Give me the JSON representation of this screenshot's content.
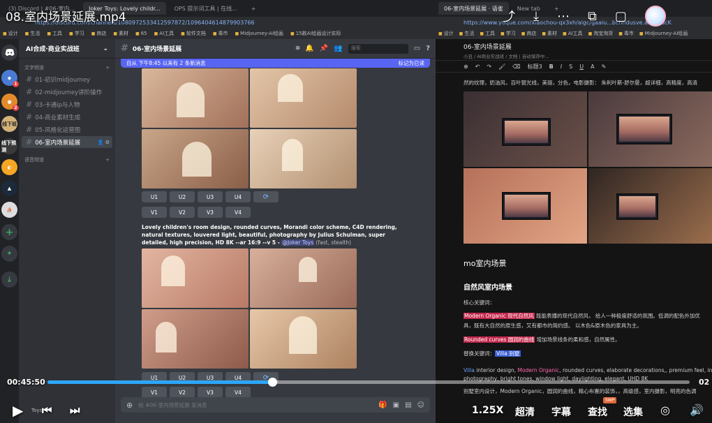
{
  "video": {
    "title": "08.室内场景延展.mp4",
    "time_current": "00:45:50",
    "time_end": "02",
    "progress": 0.35,
    "speed": "1.25X",
    "quality": "超清",
    "subtitle": "字幕",
    "search": "查找",
    "episodes": "选集",
    "swp_tag": "SWP"
  },
  "browser_left": {
    "tabs": [
      "(3) Discord | #06-室内...",
      "Joker Toys: Lovely childr...",
      "OPS 提示词工具 | 在线...",
      "+"
    ],
    "url": "https://discord.com/channels/1080972533412597872/1096404614879903766",
    "bookmarks": [
      "设计",
      "生活",
      "工具",
      "学习",
      "商店",
      "素材",
      "65",
      "AI工具",
      "软件文档",
      "毒市",
      "Midjourney-AI绘画",
      "15款AI绘画设计实际"
    ]
  },
  "discord": {
    "server_name": "AI合成·商业实战班",
    "category_text": "文字频道",
    "category_voice": "语音频道",
    "channels": [
      {
        "label": "01-初识midjourney"
      },
      {
        "label": "02-midjourney讲阶操作"
      },
      {
        "label": "03-卡通ip与人物"
      },
      {
        "label": "04-商业素材生成"
      },
      {
        "label": "05-风格化运营图"
      },
      {
        "label": "06-室内场景延展"
      }
    ],
    "guild_labels": [
      "线下班",
      "线下预测"
    ],
    "guild_badges": [
      "1",
      "2"
    ],
    "channel_title": "06-室内场景延展",
    "search_placeholder": "搜索",
    "new_messages": "自从 下午8:45 以来有 2 条新消息",
    "mark_read": "标记为已读",
    "upscale_buttons": [
      "U1",
      "U2",
      "U3",
      "U4"
    ],
    "variation_buttons": [
      "V1",
      "V2",
      "V3",
      "V4"
    ],
    "refresh_icon": "refresh-icon",
    "prompt_text": "Lovely children's room design, rounded curves, Morandi color scheme, C4D rendering, natural textures, louvered light, beautiful, photography by Julius Schulman, super detailed, high precision, HD 8K --ar 16:9 --v 5",
    "prompt_dash": " - ",
    "mention": "@Joker Toys",
    "prompt_meta": " (fast, stealth)",
    "input_placeholder": "给 #06-室内场景延展 发消息",
    "user_name": "Toys"
  },
  "yuque": {
    "tabs": [
      "06-室内场景延展 · 语雀",
      "New tab",
      "+"
    ],
    "url": "https://www.yuque.com/xiaochou-qx3xh/aigc/gaaiu...bchhdusve.aitvsodcK",
    "bookmarks": [
      "设计",
      "生活",
      "工具",
      "学习",
      "商店",
      "素材",
      "AI工具",
      "淘宝淘货",
      "毒市",
      "Midjourney-AI绘画"
    ],
    "doc_title": "06-室内场景延展",
    "doc_sub": "小丑 / AI商业实战班 / 文档 | 自动保存中...",
    "toolbar_heading": "标题3",
    "intro": "然的纹理，奶油风，百叶窗光线，美丽，分色，电影摄影： 朱利叶斯-舒尔曼，超详细，高精度，高清",
    "h2a": "mo室内场景",
    "h2b": "自然风室内场景",
    "label_core": "核心关键词：",
    "line1_hl": "Modern Organic 现代自然风",
    "line1_rest": " 既能表播的现代自然风， 给人一种极度舒适的氛围。低调的配色外加优",
    "line2": "具，既有大自然的原生感，又有都市的简约感。 以木色&原木色的家具为主。",
    "line3_hl": "Rounded curves 圆润的曲线",
    "line3_rest": " 增加场景线条的柔和感，自然属性。",
    "label_replace": "替换关键词：",
    "replace_hl": "Villa 别墅",
    "prompt_villa": "Villa",
    "prompt_interior": " interior design, ",
    "prompt_mo": "Modern Organic",
    "prompt_rest": ", rounded curves, elaborate decorations,, premium feel, in",
    "prompt_line2": "photography, bright tones, window light, daylighting, elegant, UHD 8K",
    "prompt_line3": "别墅室内设计，Modern Organic，圆润的曲线，精心布置的装饰，，高级感，室内摄影，明亮的色调"
  }
}
